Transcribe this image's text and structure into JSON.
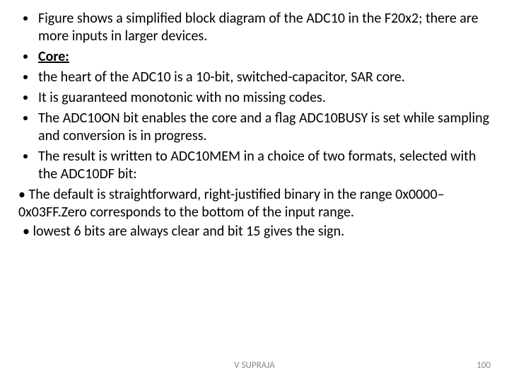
{
  "bullets": {
    "b1": "Figure shows a simplified block diagram of the ADC10 in the F20x2; there are more inputs in larger devices.",
    "b2": "Core:",
    "b3": "the heart of the ADC10 is a 10-bit, switched-capacitor, SAR core.",
    "b4": "It is guaranteed monotonic with no missing codes.",
    "b5": "The ADC10ON bit enables the core and a flag ADC10BUSY is set while sampling and conversion is in progress.",
    "b6": "The result is written to ADC10MEM in a choice of two formats, selected with the ADC10DF bit:"
  },
  "plain": {
    "p1": "• The default is straightforward, right-justified binary in the range 0x0000–0x03FF.Zero corresponds to the bottom of the input range.",
    "p2": "• lowest 6 bits are always clear and bit 15 gives the sign."
  },
  "footer": {
    "author": "V SUPRAJA",
    "page": "100"
  }
}
